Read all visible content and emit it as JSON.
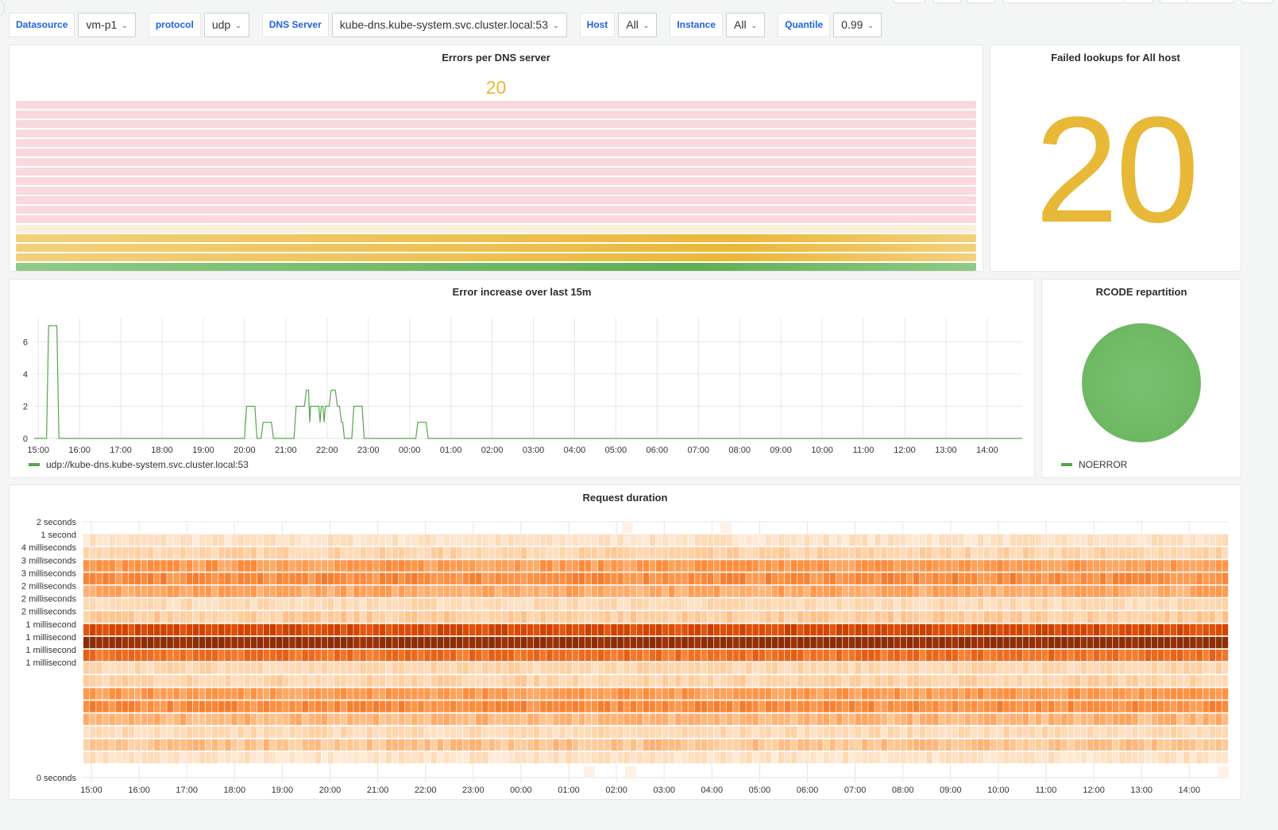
{
  "variables": [
    {
      "label": "Datasource",
      "value": "vm-p1"
    },
    {
      "label": "protocol",
      "value": "udp"
    },
    {
      "label": "DNS Server",
      "value": "kube-dns.kube-system.svc.cluster.local:53"
    },
    {
      "label": "Host",
      "value": "All"
    },
    {
      "label": "Instance",
      "value": "All"
    },
    {
      "label": "Quantile",
      "value": "0.99"
    }
  ],
  "panels": {
    "errors_per_dns": {
      "title": "Errors per DNS server",
      "value": "20",
      "value_color": "#e8b536"
    },
    "failed_lookups": {
      "title": "Failed lookups for All host",
      "value": "20",
      "value_color": "#e8b838"
    },
    "error_increase": {
      "title": "Error increase over last 15m",
      "legend": "udp://kube-dns.kube-system.svc.cluster.local:53"
    },
    "rcode": {
      "title": "RCODE repartition",
      "legend": "NOERROR"
    },
    "request_duration": {
      "title": "Request duration"
    }
  },
  "chart_data": [
    {
      "id": "errors_per_dns",
      "type": "bar",
      "title": "Errors per DNS server",
      "value": 20,
      "max": 20,
      "thresholds_colors": [
        "#56a64b",
        "#e8b536",
        "#f2cc0c",
        "#fadde2"
      ],
      "segments": 18
    },
    {
      "id": "error_increase",
      "type": "line",
      "title": "Error increase over last 15m",
      "x_ticks": [
        "15:00",
        "16:00",
        "17:00",
        "18:00",
        "19:00",
        "20:00",
        "21:00",
        "22:00",
        "23:00",
        "00:00",
        "01:00",
        "02:00",
        "03:00",
        "04:00",
        "05:00",
        "06:00",
        "07:00",
        "08:00",
        "09:00",
        "10:00",
        "11:00",
        "12:00",
        "13:00",
        "14:00"
      ],
      "y_ticks": [
        0,
        2,
        4,
        6
      ],
      "ylim": [
        0,
        7.5
      ],
      "xlim_hours": [
        -0.1,
        23.85
      ],
      "grid": true,
      "series": [
        {
          "name": "udp://kube-dns.kube-system.svc.cluster.local:53",
          "color": "#56a64b",
          "points": [
            [
              -0.1,
              0
            ],
            [
              0.2,
              0
            ],
            [
              0.25,
              7
            ],
            [
              0.45,
              7
            ],
            [
              0.5,
              0
            ],
            [
              5.0,
              0
            ],
            [
              5.05,
              2
            ],
            [
              5.25,
              2
            ],
            [
              5.3,
              0
            ],
            [
              5.4,
              0
            ],
            [
              5.45,
              1
            ],
            [
              5.65,
              1
            ],
            [
              5.7,
              0
            ],
            [
              6.2,
              0
            ],
            [
              6.25,
              2
            ],
            [
              6.45,
              2
            ],
            [
              6.5,
              3
            ],
            [
              6.55,
              3
            ],
            [
              6.58,
              1
            ],
            [
              6.6,
              2
            ],
            [
              6.8,
              2
            ],
            [
              6.83,
              1
            ],
            [
              6.86,
              2
            ],
            [
              6.9,
              2
            ],
            [
              6.93,
              1
            ],
            [
              6.96,
              2
            ],
            [
              7.05,
              2
            ],
            [
              7.1,
              3
            ],
            [
              7.2,
              3
            ],
            [
              7.25,
              2
            ],
            [
              7.3,
              2
            ],
            [
              7.35,
              1
            ],
            [
              7.38,
              1
            ],
            [
              7.42,
              0
            ],
            [
              7.6,
              0
            ],
            [
              7.65,
              2
            ],
            [
              7.85,
              2
            ],
            [
              7.9,
              0
            ],
            [
              9.15,
              0
            ],
            [
              9.2,
              1
            ],
            [
              9.4,
              1
            ],
            [
              9.45,
              0
            ],
            [
              23.85,
              0
            ]
          ]
        }
      ]
    },
    {
      "id": "rcode",
      "type": "pie",
      "title": "RCODE repartition",
      "slices": [
        {
          "label": "NOERROR",
          "value": 100,
          "color": "#73bf69"
        }
      ]
    },
    {
      "id": "request_duration",
      "type": "heatmap",
      "title": "Request duration",
      "y_ticks": [
        "2 seconds",
        "1 second",
        "4 milliseconds",
        "3 milliseconds",
        "3 milliseconds",
        "2 milliseconds",
        "2 milliseconds",
        "2 milliseconds",
        "1 millisecond",
        "1 millisecond",
        "1 millisecond",
        "1 millisecond",
        "0 seconds"
      ],
      "x_ticks": [
        "15:00",
        "16:00",
        "17:00",
        "18:00",
        "19:00",
        "20:00",
        "21:00",
        "22:00",
        "23:00",
        "00:00",
        "01:00",
        "02:00",
        "03:00",
        "04:00",
        "05:00",
        "06:00",
        "07:00",
        "08:00",
        "09:00",
        "10:00",
        "11:00",
        "12:00",
        "13:00",
        "14:00"
      ],
      "rows": 18,
      "row_intensity": [
        0.03,
        0.12,
        0.22,
        0.45,
        0.5,
        0.4,
        0.18,
        0.25,
        0.75,
        1.0,
        0.6,
        0.2,
        0.22,
        0.45,
        0.5,
        0.35,
        0.18,
        0.3,
        0.12
      ],
      "color_scale": [
        "#fff3e8",
        "#fdd0a2",
        "#fd8d3c",
        "#d94701",
        "#8c2d04"
      ]
    }
  ]
}
